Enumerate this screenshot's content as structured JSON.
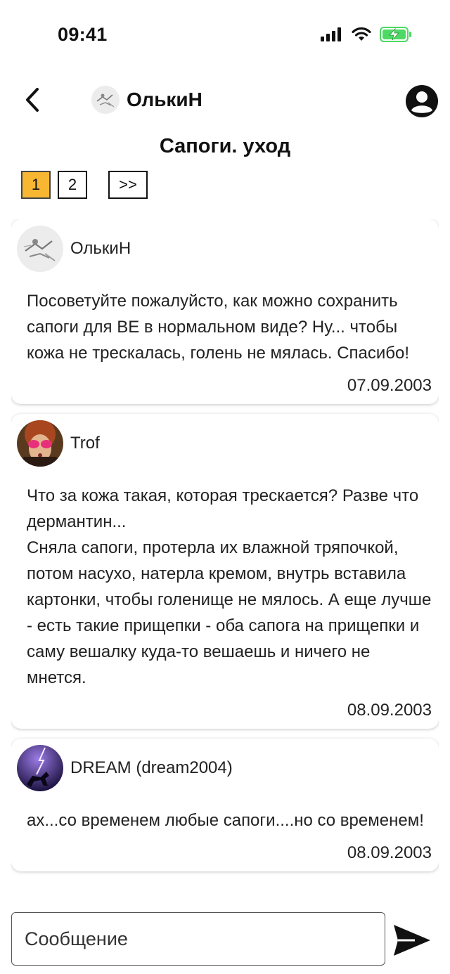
{
  "status_bar": {
    "time": "09:41",
    "icons": [
      "signal-icon",
      "wifi-icon",
      "battery-charging-icon"
    ],
    "battery_color": "#4cd964"
  },
  "header": {
    "back_icon": "chevron-left-icon",
    "user_name": "ОлькиН",
    "profile_icon": "user-circle-icon"
  },
  "topic": {
    "title": "Сапоги. уход"
  },
  "pagination": {
    "pages": [
      "1",
      "2"
    ],
    "current": "1",
    "next_label": ">>",
    "active_color": "#f7b733"
  },
  "posts": [
    {
      "author": "ОлькиН",
      "text": "Посоветуйте пожалуйсто, как можно сохранить сапоги для ВЕ в нормальном виде? Ну... чтобы кожа не трескалась, голень не мялась. Спасибо!",
      "date": "07.09.2003"
    },
    {
      "author": "Trof",
      "text": "Что за кожа такая, которая трескается? Разве что дермантин...\nСняла сапоги, протерла их влажной тряпочкой, потом насухо, натерла кремом, внутрь вставила картонки, чтобы голенище не мялось. А еще лучше - есть такие прищепки - оба сапога на прищепки и саму вешалку куда-то вешаешь и ничего не мнется.",
      "date": "08.09.2003"
    },
    {
      "author": "DREAM (dream2004)",
      "text": "ах...со временем любые сапоги....но со временем!",
      "date": "08.09.2003"
    }
  ],
  "composer": {
    "placeholder": "Сообщение",
    "send_icon": "send-arrow-icon"
  }
}
